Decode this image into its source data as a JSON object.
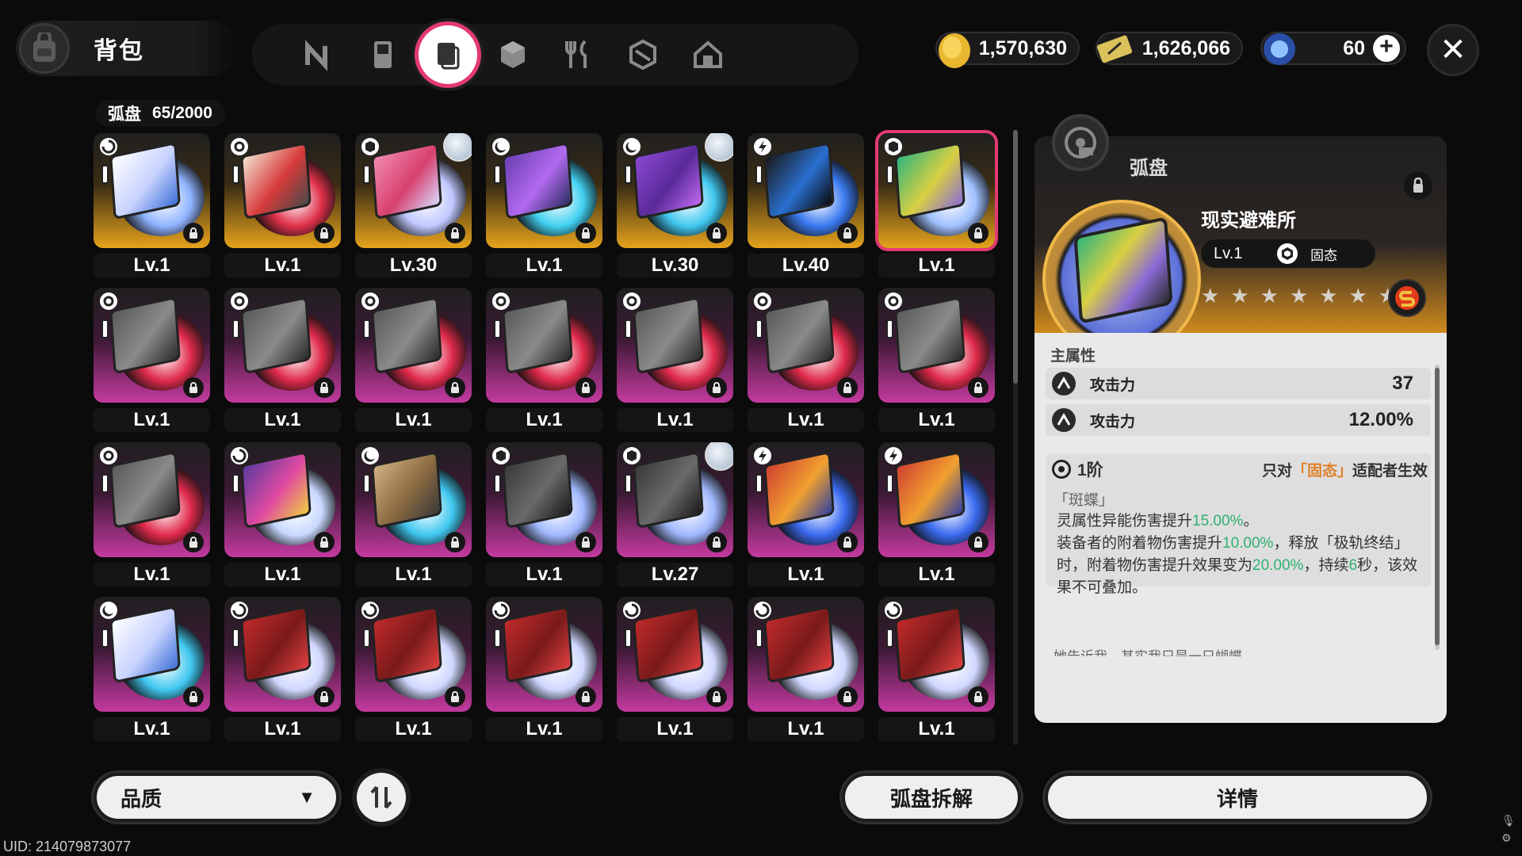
{
  "header": {
    "title": "背包",
    "tabs": [
      {
        "name": "tab-nte",
        "icon": "n-logo-icon",
        "active": false
      },
      {
        "name": "tab-gameboy",
        "icon": "handheld-console-icon",
        "active": false
      },
      {
        "name": "tab-disc",
        "icon": "arc-disc-icon",
        "active": true
      },
      {
        "name": "tab-box",
        "icon": "cube-icon",
        "active": false
      },
      {
        "name": "tab-food",
        "icon": "fork-knife-icon",
        "active": false
      },
      {
        "name": "tab-materials",
        "icon": "hexagon-package-icon",
        "active": false
      },
      {
        "name": "tab-home",
        "icon": "house-icon",
        "active": false
      }
    ],
    "currencies": [
      {
        "icon": "gold-coin-icon",
        "value": "1,570,630"
      },
      {
        "icon": "ticket-icon",
        "value": "1,626,066"
      },
      {
        "icon": "blue-crystal-icon",
        "value": "60",
        "plus": "+"
      }
    ],
    "close_label": "✕"
  },
  "inventory": {
    "category": "弧盘",
    "count": "65/2000"
  },
  "items": [
    {
      "lv": "Lv.1",
      "bg": "gold",
      "type": "spiral",
      "colors": [
        "#ffffff",
        "#c7d2ff",
        "#3b6fd6"
      ],
      "ring": "#8fb3ff",
      "avatar": false
    },
    {
      "lv": "Lv.1",
      "bg": "gold",
      "type": "gear",
      "colors": [
        "#f2e1d0",
        "#d63a3a",
        "#4a4a4a"
      ],
      "ring": "#e0304a",
      "avatar": false
    },
    {
      "lv": "Lv.30",
      "bg": "gold",
      "type": "cube",
      "colors": [
        "#f08ab0",
        "#d8406e",
        "#d9d9ff"
      ],
      "ring": "#c0c8ff",
      "avatar": true
    },
    {
      "lv": "Lv.1",
      "bg": "gold",
      "type": "crescent",
      "colors": [
        "#6a3fb0",
        "#b26af0",
        "#2c2c60"
      ],
      "ring": "#40d0f0",
      "avatar": false
    },
    {
      "lv": "Lv.30",
      "bg": "gold",
      "type": "crescent",
      "colors": [
        "#8a48d0",
        "#5a2a9a",
        "#c06af0"
      ],
      "ring": "#40c8f0",
      "avatar": true
    },
    {
      "lv": "Lv.40",
      "bg": "gold",
      "type": "bolt",
      "colors": [
        "#1a1a1a",
        "#2a6fd0",
        "#0a0a0a"
      ],
      "ring": "#3a7af0",
      "avatar": false
    },
    {
      "lv": "Lv.1",
      "bg": "gold",
      "type": "cube",
      "colors": [
        "#2fb57c",
        "#d9cf42",
        "#8a6bd6"
      ],
      "ring": "#a0c0ff",
      "avatar": false,
      "selected": true
    },
    {
      "lv": "Lv.1",
      "bg": "purple",
      "type": "gear",
      "colors": [
        "#5a5a5a",
        "#8a8a8a",
        "#2a2a2a"
      ],
      "ring": "#e02a4a",
      "avatar": false
    },
    {
      "lv": "Lv.1",
      "bg": "purple",
      "type": "gear",
      "colors": [
        "#5a5a5a",
        "#8a8a8a",
        "#2a2a2a"
      ],
      "ring": "#e02a4a",
      "avatar": false
    },
    {
      "lv": "Lv.1",
      "bg": "purple",
      "type": "gear",
      "colors": [
        "#5a5a5a",
        "#8a8a8a",
        "#2a2a2a"
      ],
      "ring": "#e02a4a",
      "avatar": false
    },
    {
      "lv": "Lv.1",
      "bg": "purple",
      "type": "gear",
      "colors": [
        "#5a5a5a",
        "#8a8a8a",
        "#2a2a2a"
      ],
      "ring": "#e02a4a",
      "avatar": false
    },
    {
      "lv": "Lv.1",
      "bg": "purple",
      "type": "gear",
      "colors": [
        "#5a5a5a",
        "#8a8a8a",
        "#2a2a2a"
      ],
      "ring": "#e02a4a",
      "avatar": false
    },
    {
      "lv": "Lv.1",
      "bg": "purple",
      "type": "gear",
      "colors": [
        "#5a5a5a",
        "#8a8a8a",
        "#2a2a2a"
      ],
      "ring": "#e02a4a",
      "avatar": false
    },
    {
      "lv": "Lv.1",
      "bg": "purple",
      "type": "gear",
      "colors": [
        "#5a5a5a",
        "#8a8a8a",
        "#2a2a2a"
      ],
      "ring": "#e02a4a",
      "avatar": false
    },
    {
      "lv": "Lv.1",
      "bg": "purple",
      "type": "gear",
      "colors": [
        "#5a5a5a",
        "#8a8a8a",
        "#2a2a2a"
      ],
      "ring": "#e02a4a",
      "avatar": false
    },
    {
      "lv": "Lv.1",
      "bg": "purple",
      "type": "spiral",
      "colors": [
        "#5a3aa0",
        "#e04aa0",
        "#f0d040"
      ],
      "ring": "#c8d8ff",
      "avatar": false
    },
    {
      "lv": "Lv.1",
      "bg": "purple",
      "type": "crescent",
      "colors": [
        "#d0b080",
        "#8a6a40",
        "#3a3a3a"
      ],
      "ring": "#40c8f0",
      "avatar": false
    },
    {
      "lv": "Lv.1",
      "bg": "purple",
      "type": "cube",
      "colors": [
        "#3a3a3a",
        "#6a6a6a",
        "#1a1a1a"
      ],
      "ring": "#a0b8ff",
      "avatar": false
    },
    {
      "lv": "Lv.27",
      "bg": "purple",
      "type": "cube",
      "colors": [
        "#3a3a3a",
        "#6a6a6a",
        "#1a1a1a"
      ],
      "ring": "#a0b8ff",
      "avatar": true
    },
    {
      "lv": "Lv.1",
      "bg": "purple",
      "type": "bolt",
      "colors": [
        "#d04030",
        "#f0a030",
        "#3040a0"
      ],
      "ring": "#3a6af0",
      "avatar": false
    },
    {
      "lv": "Lv.1",
      "bg": "purple",
      "type": "bolt",
      "colors": [
        "#d04030",
        "#f0a030",
        "#3040a0"
      ],
      "ring": "#3a6af0",
      "avatar": false
    },
    {
      "lv": "Lv.1",
      "bg": "purple",
      "type": "crescent",
      "colors": [
        "#ffffff",
        "#c7d2ff",
        "#3b6fd6"
      ],
      "ring": "#40c8f0",
      "avatar": false
    },
    {
      "lv": "Lv.1",
      "bg": "purple",
      "type": "spiral",
      "colors": [
        "#c02a2a",
        "#7a1a1a",
        "#e04040"
      ],
      "ring": "#d0d8ff",
      "avatar": false
    },
    {
      "lv": "Lv.1",
      "bg": "purple",
      "type": "spiral",
      "colors": [
        "#c02a2a",
        "#7a1a1a",
        "#e04040"
      ],
      "ring": "#d0d8ff",
      "avatar": false
    },
    {
      "lv": "Lv.1",
      "bg": "purple",
      "type": "spiral",
      "colors": [
        "#c02a2a",
        "#7a1a1a",
        "#e04040"
      ],
      "ring": "#d0d8ff",
      "avatar": false
    },
    {
      "lv": "Lv.1",
      "bg": "purple",
      "type": "spiral",
      "colors": [
        "#c02a2a",
        "#7a1a1a",
        "#e04040"
      ],
      "ring": "#d0d8ff",
      "avatar": false
    },
    {
      "lv": "Lv.1",
      "bg": "purple",
      "type": "spiral",
      "colors": [
        "#c02a2a",
        "#7a1a1a",
        "#e04040"
      ],
      "ring": "#d0d8ff",
      "avatar": false
    },
    {
      "lv": "Lv.1",
      "bg": "purple",
      "type": "spiral",
      "colors": [
        "#c02a2a",
        "#7a1a1a",
        "#e04040"
      ],
      "ring": "#d0d8ff",
      "avatar": false
    }
  ],
  "detail": {
    "category": "弧盘",
    "name": "现实避难所",
    "level": "Lv.1",
    "attribute": "固态",
    "stars": [
      "★",
      "★",
      "★",
      "★",
      "★",
      "★",
      "★"
    ],
    "rank_icon": "s-rank-icon",
    "main_attr_title": "主属性",
    "stats": [
      {
        "name": "攻击力",
        "value": "37"
      },
      {
        "name": "攻击力",
        "value": "12.00%"
      }
    ],
    "set_tier": "1阶",
    "set_cond_pre": "只对",
    "set_cond_hl": "「固态」",
    "set_cond_post": "适配者生效",
    "set_name": "「斑蝶」",
    "desc_1a": "灵属性异能伤害提升",
    "desc_1b": "15.00%",
    "desc_1c": "。",
    "desc_2a": "装备者的附着物伤害提升",
    "desc_2b": "10.00%",
    "desc_2c": "，释放「极轨终结」时，附着物伤害提升效果变为",
    "desc_2d": "20.00%",
    "desc_2e": "，持续",
    "desc_2f": "6",
    "desc_2g": "秒，该效果不可叠加。",
    "flavor": "她告诉我，其实我只是一只蝴蝶"
  },
  "footer": {
    "sort_label": "品质",
    "sort_arrow": "▼",
    "dismantle_label": "弧盘拆解",
    "details_label": "详情",
    "uid": "UID: 214079873077"
  }
}
